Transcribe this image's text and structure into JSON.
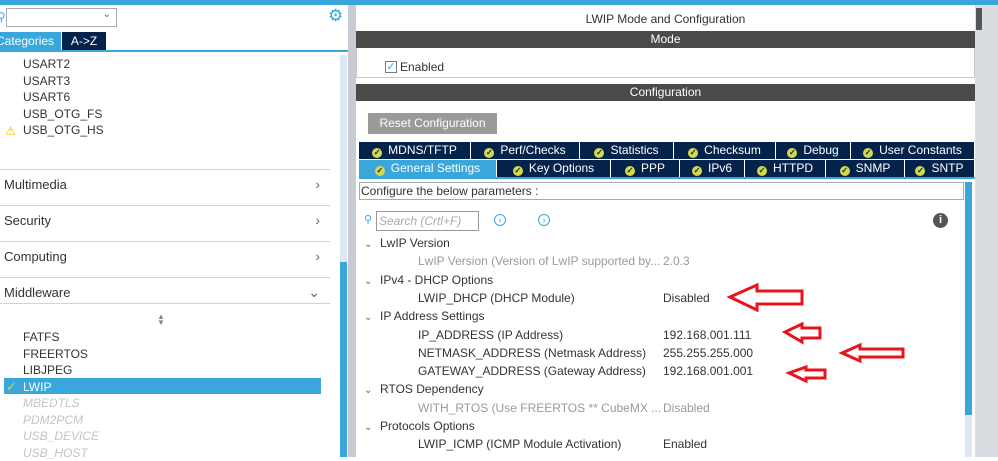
{
  "left": {
    "search_placeholder": "",
    "tabs": [
      "Categories",
      "A->Z"
    ],
    "top_items": [
      {
        "label": "USART2",
        "warning": false
      },
      {
        "label": "USART3",
        "warning": false
      },
      {
        "label": "USART6",
        "warning": false
      },
      {
        "label": "USB_OTG_FS",
        "warning": false
      },
      {
        "label": "USB_OTG_HS",
        "warning": true
      }
    ],
    "categories": [
      "Multimedia",
      "Security",
      "Computing",
      "Middleware"
    ],
    "middleware_items": [
      {
        "label": "FATFS",
        "state": "normal"
      },
      {
        "label": "FREERTOS",
        "state": "normal"
      },
      {
        "label": "LIBJPEG",
        "state": "normal"
      },
      {
        "label": "LWIP",
        "state": "selected"
      },
      {
        "label": "MBEDTLS",
        "state": "disabled"
      },
      {
        "label": "PDM2PCM",
        "state": "disabled"
      },
      {
        "label": "USB_DEVICE",
        "state": "disabled"
      },
      {
        "label": "USB_HOST",
        "state": "disabled"
      }
    ]
  },
  "right": {
    "title": "LWIP Mode and Configuration",
    "mode_header": "Mode",
    "enabled_label": "Enabled",
    "enabled_checked": true,
    "config_header": "Configuration",
    "reset_button": "Reset Configuration",
    "tabs_row1": [
      "MDNS/TFTP",
      "Perf/Checks",
      "Statistics",
      "Checksum",
      "Debug",
      "User Constants"
    ],
    "tabs_row2": [
      "General Settings",
      "Key Options",
      "PPP",
      "IPv6",
      "HTTPD",
      "SNMP",
      "SNTP"
    ],
    "active_tab": "General Settings",
    "configure_text": "Configure the below parameters :",
    "search_placeholder": "Search (Crtl+F)",
    "sections": [
      {
        "title": "LwIP Version",
        "params": [
          {
            "name": "LwIP Version (Version of LwIP supported by...",
            "value": "2.0.3",
            "disabled": true
          }
        ]
      },
      {
        "title": "IPv4 - DHCP Options",
        "params": [
          {
            "name": "LWIP_DHCP (DHCP Module)",
            "value": "Disabled",
            "disabled": false
          }
        ]
      },
      {
        "title": "IP Address Settings",
        "params": [
          {
            "name": "IP_ADDRESS (IP Address)",
            "value": "192.168.001.111",
            "disabled": false
          },
          {
            "name": "NETMASK_ADDRESS (Netmask Address)",
            "value": "255.255.255.000",
            "disabled": false
          },
          {
            "name": "GATEWAY_ADDRESS (Gateway Address)",
            "value": "192.168.001.001",
            "disabled": false
          }
        ]
      },
      {
        "title": "RTOS Dependency",
        "params": [
          {
            "name": "WITH_RTOS (Use FREERTOS ** CubeMX ...",
            "value": "Disabled",
            "disabled": true
          }
        ]
      },
      {
        "title": "Protocols Options",
        "params": [
          {
            "name": "LWIP_ICMP (ICMP Module Activation)",
            "value": "Enabled",
            "disabled": false
          }
        ]
      }
    ]
  },
  "colors": {
    "accent": "#39a7dc",
    "tab_dark": "#03234b",
    "annotation_arrow": "#e8141b"
  }
}
